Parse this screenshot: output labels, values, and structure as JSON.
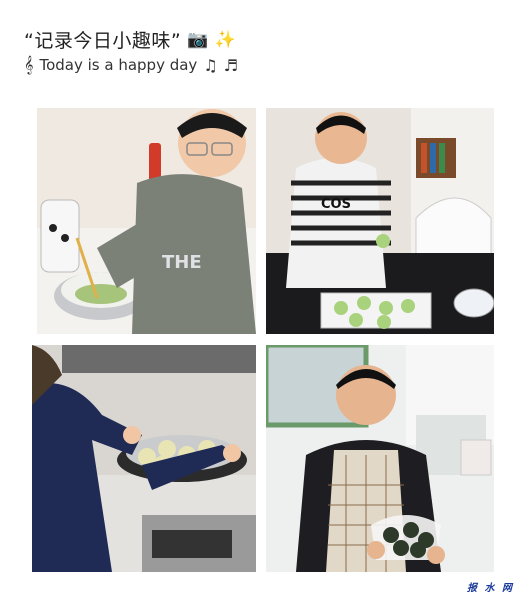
{
  "header": {
    "title": "“记录今日小趣味”",
    "title_icons": [
      "camera-icon",
      "sparkles-icon"
    ],
    "subtitle": "Today is a happy day",
    "subtitle_icons": [
      "music-score-icon",
      "music-notes-icon",
      "music-note-icon"
    ]
  },
  "photos": [
    {
      "name": "photo-boy-mixing-dough",
      "shirt_text": "THE"
    },
    {
      "name": "photo-boy-shaping-dumplings",
      "shirt_text": "COS"
    },
    {
      "name": "photo-girl-steaming-dumplings"
    },
    {
      "name": "photo-boy-holding-dumplings"
    }
  ],
  "watermark": "报 水 网",
  "colors": {
    "background": "#ffffff",
    "watermark": "#1a3a9a"
  }
}
